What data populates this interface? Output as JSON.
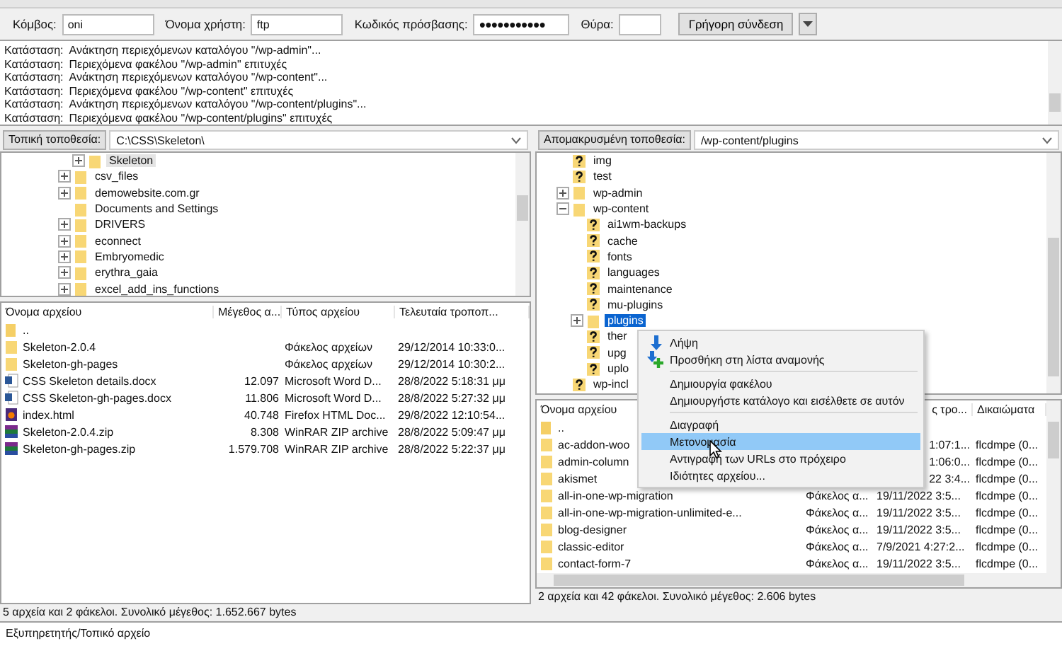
{
  "quickconnect": {
    "fields": [
      {
        "label": "Κόμβος:",
        "value": "oni",
        "kind": "text"
      },
      {
        "label": "Όνομα χρήστη:",
        "value": "ftp",
        "kind": "text"
      },
      {
        "label": "Κωδικός πρόσβασης:",
        "value": "●●●●●●●●●●●",
        "kind": "password"
      },
      {
        "label": "Θύρα:",
        "kind": "port"
      }
    ],
    "button": "Γρήγορη σύνδεση"
  },
  "log": [
    {
      "label": "Κατάσταση:",
      "message": "Ανάκτηση περιεχόμενων καταλόγου \"/wp-admin\"..."
    },
    {
      "label": "Κατάσταση:",
      "message": "Περιεχόμενα φακέλου \"/wp-admin\" επιτυχές"
    },
    {
      "label": "Κατάσταση:",
      "message": "Ανάκτηση περιεχόμενων καταλόγου \"/wp-content\"..."
    },
    {
      "label": "Κατάσταση:",
      "message": "Περιεχόμενα φακέλου \"/wp-content\" επιτυχές"
    },
    {
      "label": "Κατάσταση:",
      "message": "Ανάκτηση περιεχόμενων καταλόγου \"/wp-content/plugins\"..."
    },
    {
      "label": "Κατάσταση:",
      "message": "Περιεχόμενα φακέλου \"/wp-content/plugins\" επιτυχές"
    }
  ],
  "local": {
    "location_label": "Τοπική τοποθεσία:",
    "path": "C:\\CSS\\Skeleton\\",
    "tree": [
      {
        "children": [
          {
            "label": "Skeleton",
            "kind": "folder",
            "expandable": true,
            "expanded": false,
            "selected": true
          }
        ]
      },
      {
        "label": "csv_files",
        "kind": "folder",
        "expandable": true,
        "expanded": false,
        "selected": false
      },
      {
        "label": "demowebsite.com.gr",
        "kind": "folder",
        "expandable": true,
        "expanded": false,
        "selected": false
      },
      {
        "label": "Documents and Settings",
        "kind": "folder",
        "expandable": false,
        "expanded": false,
        "selected": false
      },
      {
        "label": "DRIVERS",
        "kind": "folder",
        "expandable": true,
        "expanded": false,
        "selected": false
      },
      {
        "label": "econnect",
        "kind": "folder",
        "expandable": true,
        "expanded": false,
        "selected": false
      },
      {
        "label": "Embryomedic",
        "kind": "folder",
        "expandable": true,
        "expanded": false,
        "selected": false
      },
      {
        "label": "erythra_gaia",
        "kind": "folder",
        "expandable": true,
        "expanded": false,
        "selected": false
      },
      {
        "label": "excel_add_ins_functions",
        "kind": "folder",
        "expandable": true,
        "expanded": false,
        "selected": false
      }
    ],
    "columns": {
      "name": "Όνομα αρχείου",
      "size": "Μέγεθος α...",
      "type": "Τύπος αρχείου",
      "modified": "Τελευταία τροποπ..."
    },
    "files": [
      {
        "kind": "parent",
        "name": ".."
      },
      {
        "kind": "folder",
        "name": "Skeleton-2.0.4",
        "type": "Φάκελος αρχείων",
        "modified": "29/12/2014 10:33:0..."
      },
      {
        "kind": "folder",
        "name": "Skeleton-gh-pages",
        "type": "Φάκελος αρχείων",
        "modified": "29/12/2014 10:30:2..."
      },
      {
        "kind": "docx",
        "name": "CSS Skeleton details.docx",
        "size": "12.097",
        "type": "Microsoft Word D...",
        "modified": "28/8/2022 5:18:31 μμ"
      },
      {
        "kind": "docx",
        "name": "CSS Skeleton-gh-pages.docx",
        "size": "11.806",
        "type": "Microsoft Word D...",
        "modified": "28/8/2022 5:27:32 μμ"
      },
      {
        "kind": "html",
        "name": "index.html",
        "size": "40.748",
        "type": "Firefox HTML Doc...",
        "modified": "29/8/2022 12:10:54..."
      },
      {
        "kind": "zip",
        "name": "Skeleton-2.0.4.zip",
        "size": "8.308",
        "type": "WinRAR ZIP archive",
        "modified": "28/8/2022 5:09:47 μμ"
      },
      {
        "kind": "zip",
        "name": "Skeleton-gh-pages.zip",
        "size": "1.579.708",
        "type": "WinRAR ZIP archive",
        "modified": "28/8/2022 5:22:37 μμ"
      }
    ],
    "status": "5 αρχεία και 2 φάκελοι. Συνολικό μέγεθος: 1.652.667 bytes"
  },
  "remote": {
    "location_label": "Απομακρυσμένη τοποθεσία:",
    "path": "/wp-content/plugins",
    "tree": [
      {
        "label": "img",
        "kind": "unknown",
        "expandable": false,
        "expanded": false,
        "selected": false
      },
      {
        "label": "test",
        "kind": "unknown",
        "expandable": false,
        "expanded": false,
        "selected": false
      },
      {
        "label": "wp-admin",
        "kind": "folder",
        "expandable": true,
        "expanded": false,
        "selected": false
      },
      {
        "label": "wp-content",
        "kind": "folder",
        "expandable": true,
        "expanded": true,
        "selected": false,
        "children": [
          {
            "label": "ai1wm-backups",
            "kind": "unknown",
            "expandable": false,
            "expanded": false,
            "selected": false
          },
          {
            "label": "cache",
            "kind": "unknown",
            "expandable": false,
            "expanded": false,
            "selected": false
          },
          {
            "label": "fonts",
            "kind": "unknown",
            "expandable": false,
            "expanded": false,
            "selected": false
          },
          {
            "label": "languages",
            "kind": "unknown",
            "expandable": false,
            "expanded": false,
            "selected": false
          },
          {
            "label": "maintenance",
            "kind": "unknown",
            "expandable": false,
            "expanded": false,
            "selected": false
          },
          {
            "label": "mu-plugins",
            "kind": "unknown",
            "expandable": false,
            "expanded": false,
            "selected": false
          },
          {
            "label": "plugins",
            "kind": "folder",
            "expandable": true,
            "expanded": false,
            "selected": true
          },
          {
            "label": "ther",
            "kind": "unknown",
            "expandable": false,
            "expanded": false,
            "selected": false
          },
          {
            "label": "upg",
            "kind": "unknown",
            "expandable": false,
            "expanded": false,
            "selected": false
          },
          {
            "label": "uplo",
            "kind": "unknown",
            "expandable": false,
            "expanded": false,
            "selected": false
          }
        ]
      },
      {
        "label": "wp-incl",
        "kind": "unknown",
        "expandable": false,
        "expanded": false,
        "selected": false
      }
    ],
    "columns": {
      "name": "Όνομα αρχείου",
      "modified": "ς τρο...",
      "permissions": "Δικαιώματα"
    },
    "files": [
      {
        "kind": "parent",
        "name": ".."
      },
      {
        "kind": "folder",
        "name": "ac-addon-woo",
        "modified": "1:07:1...",
        "permissions": "flcdmpe (0..."
      },
      {
        "kind": "folder",
        "name": "admin-column",
        "modified": "1:06:0...",
        "permissions": "flcdmpe (0..."
      },
      {
        "kind": "folder",
        "name": "akismet",
        "modified": "22 3:4...",
        "permissions": "flcdmpe (0..."
      },
      {
        "kind": "folder",
        "name": "all-in-one-wp-migration",
        "type": "Φάκελος α...",
        "modified": "19/11/2022 3:5...",
        "permissions": "flcdmpe (0..."
      },
      {
        "kind": "folder",
        "name": "all-in-one-wp-migration-unlimited-e...",
        "type": "Φάκελος α...",
        "modified": "19/11/2022 3:5...",
        "permissions": "flcdmpe (0..."
      },
      {
        "kind": "folder",
        "name": "blog-designer",
        "type": "Φάκελος α...",
        "modified": "19/11/2022 3:5...",
        "permissions": "flcdmpe (0..."
      },
      {
        "kind": "folder",
        "name": "classic-editor",
        "type": "Φάκελος α...",
        "modified": "7/9/2021 4:27:2...",
        "permissions": "flcdmpe (0..."
      },
      {
        "kind": "folder",
        "name": "contact-form-7",
        "type": "Φάκελος α...",
        "modified": "19/11/2022 3:5...",
        "permissions": "flcdmpe (0..."
      }
    ],
    "status": "2 αρχεία και 42 φάκελοι. Συνολικό μέγεθος: 2.606 bytes"
  },
  "context_menu": {
    "items": [
      {
        "kind": "download",
        "label": "Λήψη",
        "selected": false
      },
      {
        "kind": "enqueue",
        "label": "Προσθήκη στη λίστα αναμονής",
        "selected": false
      },
      {
        "kind": "separator"
      },
      {
        "kind": "item",
        "label": "Δημιουργία φακέλου",
        "selected": false
      },
      {
        "kind": "item",
        "label": "Δημιουργήστε κατάλογο και εισέλθετε σε αυτόν",
        "selected": false
      },
      {
        "kind": "separator"
      },
      {
        "kind": "item",
        "label": "Διαγραφή",
        "selected": false
      },
      {
        "kind": "item",
        "label": "Μετονομασία",
        "selected": true
      },
      {
        "kind": "item",
        "label": "Αντιγραφή των URLs στο πρόχειρο",
        "selected": false
      },
      {
        "kind": "item",
        "label": "Ιδιότητες αρχείου...",
        "selected": false
      }
    ]
  },
  "queue": {
    "column": "Εξυπηρετητής/Τοπικό αρχείο"
  }
}
